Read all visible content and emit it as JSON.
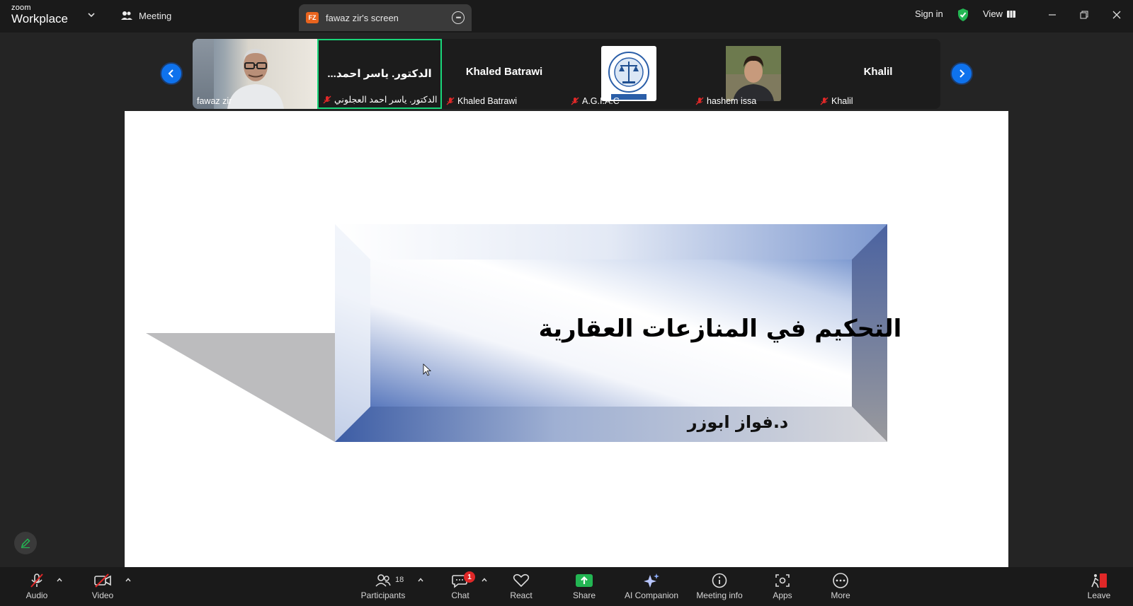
{
  "app": {
    "brand_small": "zoom",
    "brand_large": "Workplace"
  },
  "titlebar": {
    "meeting_label": "Meeting",
    "tab_badge": "FZ",
    "tab_title": "fawaz zir's screen",
    "signin": "Sign in",
    "view": "View"
  },
  "gallery": {
    "tiles": [
      {
        "label": "fawaz zir",
        "big_name": ""
      },
      {
        "label": "الدكتور. ياسر احمد العجلوني",
        "big_name": "...الدكتور. ياسر احمد"
      },
      {
        "label": "Khaled Batrawi",
        "big_name": "Khaled Batrawi"
      },
      {
        "label": "A.G.I.A.C",
        "big_name": ""
      },
      {
        "label": "hashem issa",
        "big_name": ""
      },
      {
        "label": "Khalil",
        "big_name": "Khalil"
      }
    ]
  },
  "slide": {
    "title": "التحكيم في المنازعات العقارية",
    "author": "د.فواز ابوزر"
  },
  "toolbar": {
    "audio": "Audio",
    "video": "Video",
    "participants": "Participants",
    "participants_count": "18",
    "chat": "Chat",
    "chat_badge": "1",
    "react": "React",
    "share": "Share",
    "ai_companion": "AI Companion",
    "meeting_info": "Meeting info",
    "apps": "Apps",
    "more": "More",
    "leave": "Leave"
  },
  "colors": {
    "accent_blue": "#0e72ed",
    "active_speaker": "#19d67a",
    "share_green": "#23b653",
    "leave_red": "#e02828"
  }
}
